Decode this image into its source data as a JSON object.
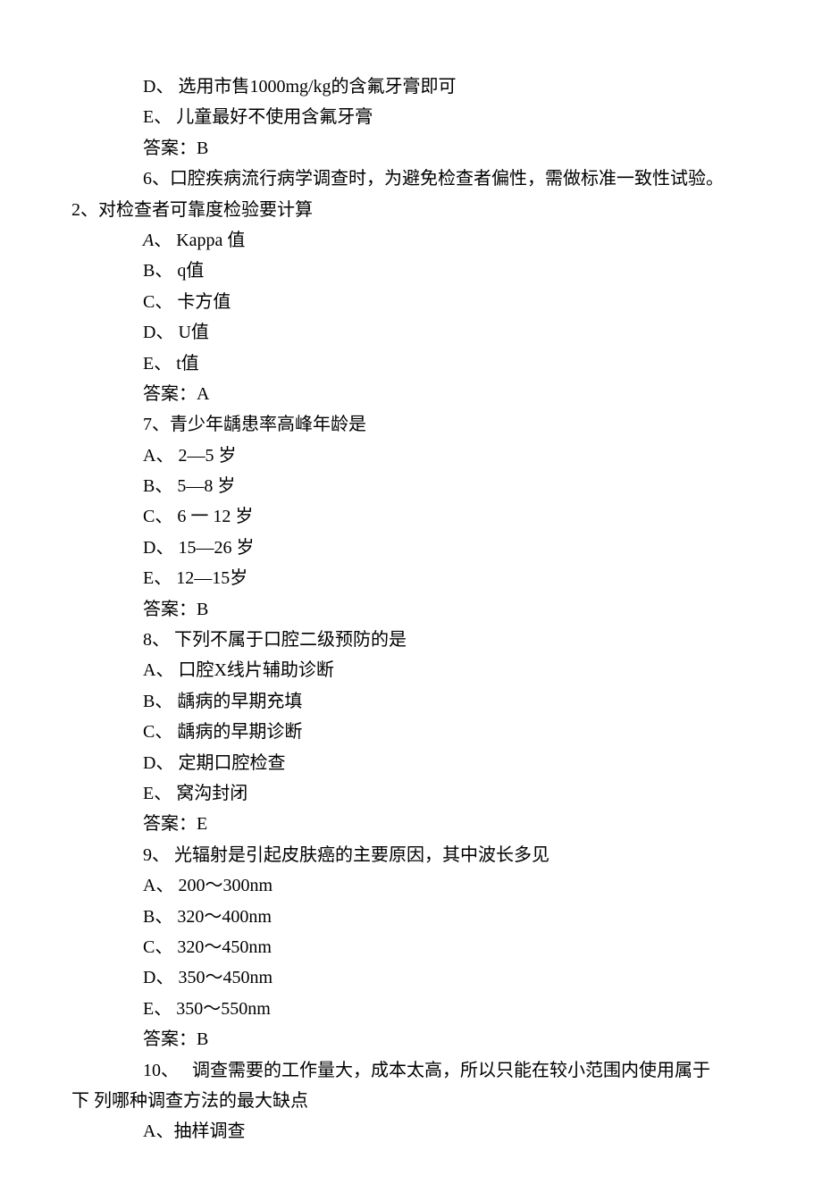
{
  "lines": [
    {
      "cls": "first-indent",
      "text": "D、 选用市售1000mg/kg的含氟牙膏即可"
    },
    {
      "cls": "first-indent",
      "text": "E、 儿童最好不使用含氟牙膏"
    },
    {
      "cls": "first-indent",
      "text": "答案：B"
    },
    {
      "cls": "first-indent",
      "text": "6、口腔疾病流行病学调查时，为避免检查者偏性，需做标准一致性试验。"
    },
    {
      "cls": "hang-indent",
      "text": "2、对检查者可靠度检验要计算"
    },
    {
      "cls": "first-indent",
      "prefix_italic": "A",
      "text": "、 Kappa 值"
    },
    {
      "cls": "first-indent",
      "text": "B、 q值"
    },
    {
      "cls": "first-indent",
      "text": "C、 卡方值"
    },
    {
      "cls": "first-indent",
      "text": "D、 U值"
    },
    {
      "cls": "first-indent",
      "text": "E、 t值"
    },
    {
      "cls": "first-indent",
      "text": "答案：A"
    },
    {
      "cls": "first-indent",
      "text": "7、青少年龋患率高峰年龄是"
    },
    {
      "cls": "first-indent",
      "text": "A、 2—5 岁"
    },
    {
      "cls": "first-indent",
      "text": "B、 5—8 岁"
    },
    {
      "cls": "first-indent",
      "text": "C、 6 一 12 岁"
    },
    {
      "cls": "first-indent",
      "text": "D、 15—26 岁"
    },
    {
      "cls": "first-indent",
      "text": "E、 12—15岁"
    },
    {
      "cls": "first-indent",
      "text": "答案：B"
    },
    {
      "cls": "first-indent",
      "text": "8、 下列不属于口腔二级预防的是"
    },
    {
      "cls": "first-indent",
      "text": "A、 口腔X线片辅助诊断"
    },
    {
      "cls": "first-indent",
      "text": "B、 龋病的早期充填"
    },
    {
      "cls": "first-indent",
      "text": "C、 龋病的早期诊断"
    },
    {
      "cls": "first-indent",
      "text": "D、 定期口腔检查"
    },
    {
      "cls": "first-indent",
      "text": "E、 窝沟封闭"
    },
    {
      "cls": "first-indent",
      "text": "答案：E"
    },
    {
      "cls": "first-indent",
      "text": "9、 光辐射是引起皮肤癌的主要原因，其中波长多见"
    },
    {
      "cls": "first-indent",
      "text": "A、 200～300nm"
    },
    {
      "cls": "first-indent",
      "text": "B、 320～400nm"
    },
    {
      "cls": "first-indent",
      "text": "C、 320～450nm"
    },
    {
      "cls": "first-indent",
      "text": "D、 350～450nm"
    },
    {
      "cls": "first-indent",
      "text": "E、 350～550nm"
    },
    {
      "cls": "first-indent",
      "text": "答案：B"
    },
    {
      "cls": "first-indent",
      "text": "10、   调查需要的工作量大，成本太高，所以只能在较小范围内使用属于"
    },
    {
      "cls": "hang-indent",
      "text": "下 列哪种调查方法的最大缺点"
    },
    {
      "cls": "first-indent",
      "text": "A、抽样调查"
    }
  ]
}
